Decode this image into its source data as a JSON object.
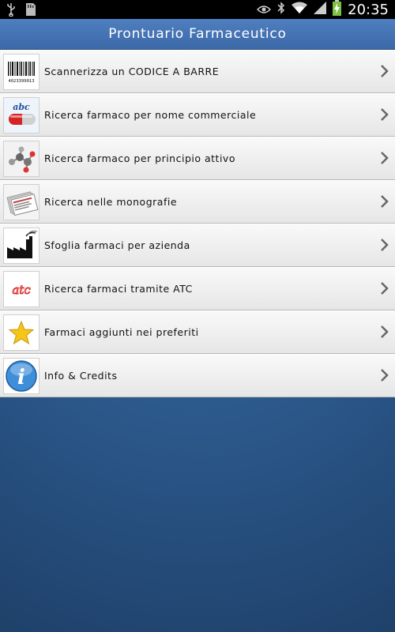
{
  "status_bar": {
    "time": "20:35",
    "left_icons": [
      "usb-icon",
      "sd-card-icon"
    ],
    "right_icons": [
      "eye-icon",
      "bluetooth-icon",
      "wifi-icon",
      "signal-icon",
      "battery-charging-icon"
    ]
  },
  "header": {
    "title": "Prontuario Farmaceutico",
    "color": "#4673b3"
  },
  "menu": {
    "items": [
      {
        "label": "Scannerizza un CODICE A BARRE",
        "icon": "barcode-icon",
        "barcode_number": "4023399013"
      },
      {
        "label": "Ricerca farmaco per nome commerciale",
        "icon": "abc-pill-icon",
        "icon_text": "abc"
      },
      {
        "label": "Ricerca farmaco per principio attivo",
        "icon": "molecule-icon"
      },
      {
        "label": "Ricerca nelle monografie",
        "icon": "documents-icon"
      },
      {
        "label": "Sfoglia farmaci per azienda",
        "icon": "factory-icon"
      },
      {
        "label": "Ricerca farmaci tramite ATC",
        "icon": "atc-icon",
        "icon_text": "atc"
      },
      {
        "label": "Farmaci aggiunti nei preferiti",
        "icon": "star-icon"
      },
      {
        "label": "Info & Credits",
        "icon": "info-icon",
        "icon_text": "i"
      }
    ]
  },
  "colors": {
    "background": "#2a5688",
    "row": "#efefef",
    "chevron": "#666666"
  }
}
